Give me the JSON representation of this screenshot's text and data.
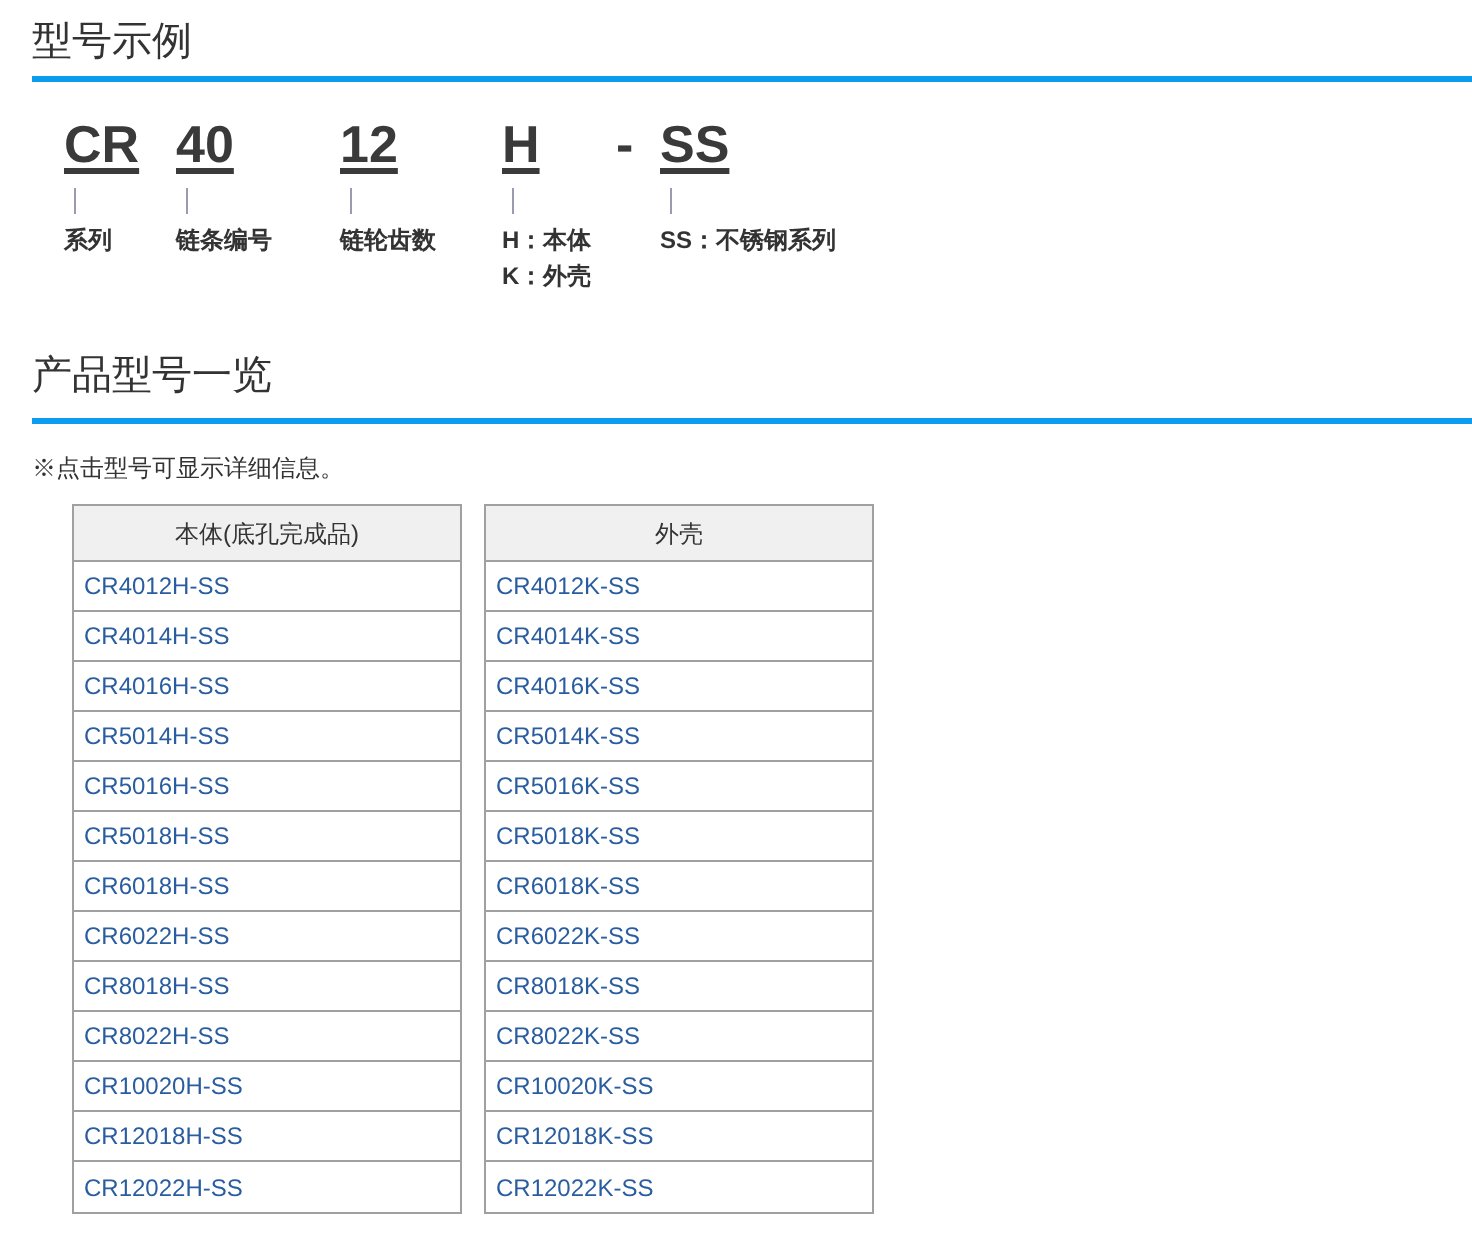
{
  "example_section": {
    "title": "型号示例",
    "parts": [
      {
        "kind": "segment",
        "code": "CR",
        "notes": [
          "系列"
        ]
      },
      {
        "kind": "segment",
        "code": "40",
        "notes": [
          "链条编号"
        ]
      },
      {
        "kind": "segment",
        "code": "12",
        "notes": [
          "链轮齿数"
        ]
      },
      {
        "kind": "segment",
        "code": "H",
        "notes": [
          "H：本体",
          "K：外壳"
        ]
      },
      {
        "kind": "separator",
        "code": "-"
      },
      {
        "kind": "segment",
        "code": "SS",
        "notes": [
          "SS：不锈钢系列"
        ]
      }
    ]
  },
  "list_section": {
    "title": "产品型号一览",
    "note": "※点击型号可显示详细信息。",
    "tables": [
      {
        "header": "本体(底孔完成品)",
        "rows": [
          "CR4012H-SS",
          "CR4014H-SS",
          "CR4016H-SS",
          "CR5014H-SS",
          "CR5016H-SS",
          "CR5018H-SS",
          "CR6018H-SS",
          "CR6022H-SS",
          "CR8018H-SS",
          "CR8022H-SS",
          "CR10020H-SS",
          "CR12018H-SS",
          "CR12022H-SS"
        ]
      },
      {
        "header": "外壳",
        "rows": [
          "CR4012K-SS",
          "CR4014K-SS",
          "CR4016K-SS",
          "CR5014K-SS",
          "CR5016K-SS",
          "CR5018K-SS",
          "CR6018K-SS",
          "CR6022K-SS",
          "CR8018K-SS",
          "CR8022K-SS",
          "CR10020K-SS",
          "CR12018K-SS",
          "CR12022K-SS"
        ]
      }
    ]
  }
}
